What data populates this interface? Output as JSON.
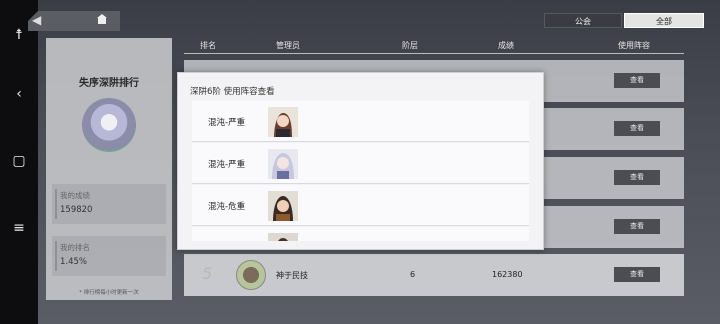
{
  "filters": {
    "guild": "公会",
    "all": "全部"
  },
  "left_panel": {
    "title": "失序深阱排行",
    "my_score_label": "我的成绩",
    "my_score": "159820",
    "my_rank_label": "我的排名",
    "my_rank": "1.45%",
    "footnote": "* 排行榜每小时更新一次"
  },
  "table": {
    "headers": [
      "排名",
      "管理员",
      "阶层",
      "成绩",
      "使用阵容"
    ],
    "view_label": "查看",
    "row5": {
      "rank": "5",
      "name": "神于民技",
      "tier": "6",
      "score": "162380"
    }
  },
  "modal": {
    "title": "深阱6阶 使用阵容查看",
    "items": [
      {
        "label": "混沌-严重"
      },
      {
        "label": "混沌-严重"
      },
      {
        "label": "混沌-危重"
      }
    ]
  },
  "colors": {
    "accent": "#4b4d52",
    "panel": "#c8cacd"
  },
  "icons": [
    "accessibility-icon",
    "back-icon",
    "home-icon"
  ]
}
